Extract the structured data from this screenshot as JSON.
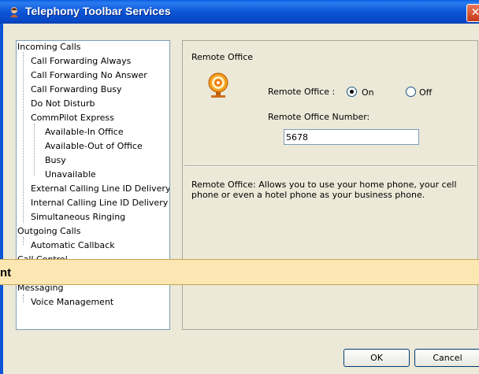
{
  "window": {
    "title": "Telephony Toolbar Services",
    "close_glyph": "✕"
  },
  "tree": {
    "items": [
      "Incoming Calls",
      "Call Forwarding Always",
      "Call Forwarding No Answer",
      "Call Forwarding Busy",
      "Do Not Disturb",
      "CommPilot Express",
      "Available-In Office",
      "Available-Out of Office",
      "Busy",
      "Unavailable",
      "External Calling Line ID Delivery",
      "Internal Calling Line ID Delivery",
      "Simultaneous Ringing",
      "Outgoing Calls",
      "Automatic Callback",
      "Call Control",
      "Messaging",
      "Voice Management"
    ]
  },
  "panel": {
    "section_label": "Remote Office",
    "remote_office_label": "Remote Office :",
    "on_label": "On",
    "off_label": "Off",
    "selected": "On",
    "number_label": "Remote Office Number:",
    "number_value": "5678",
    "description": "Remote Office: Allows you to use your home phone, your cell phone or even a hotel phone as your business phone."
  },
  "banner": {
    "text": "nt"
  },
  "buttons": {
    "ok": "OK",
    "cancel": "Cancel"
  },
  "colors": {
    "titlebar": "#0b55d6",
    "banner": "#fce7b3",
    "dialog": "#ece9d8"
  }
}
